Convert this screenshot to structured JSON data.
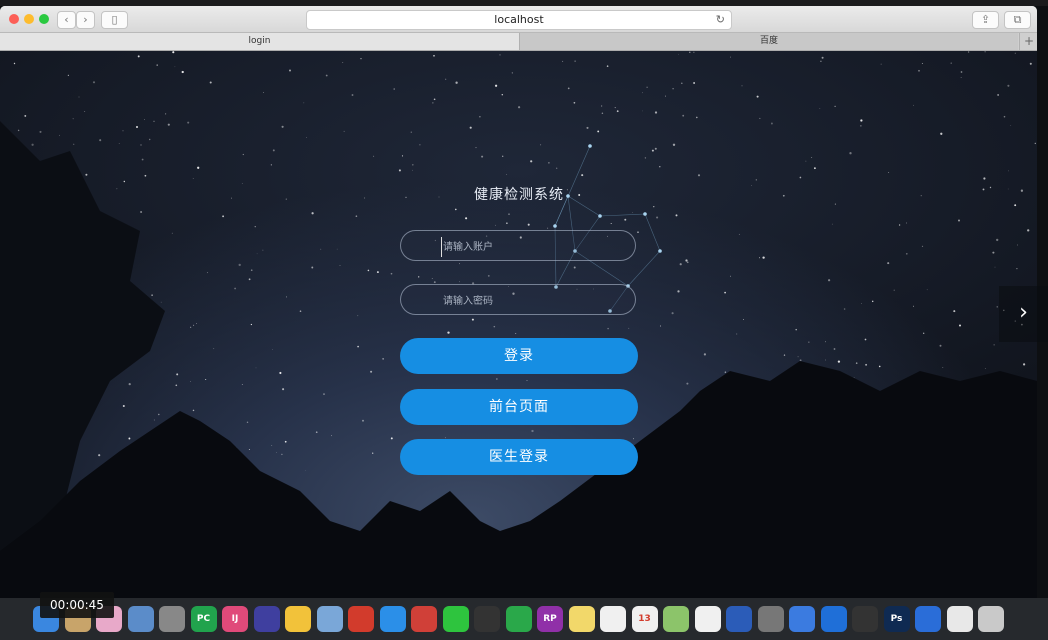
{
  "browser": {
    "address": "localhost",
    "tabs": [
      {
        "label": "login",
        "active": true
      },
      {
        "label": "百度",
        "active": false
      }
    ]
  },
  "login": {
    "title": "健康检测系统",
    "username_placeholder": "请输入账户",
    "password_placeholder": "请输入密码",
    "login_button": "登录",
    "frontend_button": "前台页面",
    "doctor_login_button": "医生登录"
  },
  "colors": {
    "button": "#168ee3",
    "button_text": "#ffffff"
  },
  "dock": {
    "icons": [
      "finder-icon",
      "launchpad-icon",
      "photos-icon",
      "preview-icon",
      "rocket-icon",
      "pycharm-icon",
      "intellij-icon",
      "eclipse-icon",
      "duck-icon",
      "database-icon",
      "redis-icon",
      "safari-icon",
      "presentation-icon",
      "wechat-icon",
      "qq-icon",
      "music-icon",
      "axure-icon",
      "notes-icon",
      "reminders-icon",
      "calendar-icon",
      "maps-icon",
      "itunes-icon",
      "word-icon",
      "system-preferences-icon",
      "baidu-netdisk-icon",
      "teamviewer-icon",
      "qq-icon",
      "photoshop-icon",
      "webstorm-icon",
      "documents-icon",
      "trash-icon"
    ],
    "calendar_day": "13",
    "ps_label": "Ps",
    "pc_label": "PC",
    "ij_label": "IJ",
    "rp_label": "RP"
  },
  "overlay": {
    "timestamp": "00:00:45"
  }
}
